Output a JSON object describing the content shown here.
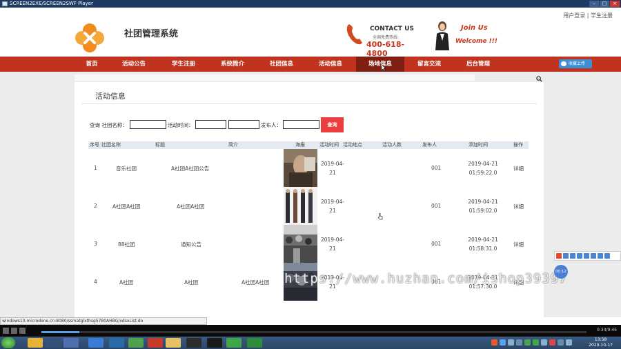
{
  "window": {
    "title": "SCREEN2EXE/SCREEN2SWF Player"
  },
  "header": {
    "top_links": "用户登录 | 学生注册",
    "site_name": "社团管理系统",
    "contact_title": "CONTACT US",
    "contact_sub": "全国免费热线:",
    "contact_phone": "400-618-4800",
    "join_line1": "Join Us",
    "join_line2": "Welcome !!!"
  },
  "nav": {
    "items": [
      {
        "label": "首页"
      },
      {
        "label": "活动公告"
      },
      {
        "label": "学生注册"
      },
      {
        "label": "系统简介"
      },
      {
        "label": "社团信息"
      },
      {
        "label": "活动信息"
      },
      {
        "label": "场地信息"
      },
      {
        "label": "留言交流"
      },
      {
        "label": "后台管理"
      }
    ],
    "active_index": 6,
    "share_label": "收藏上传"
  },
  "page": {
    "title": "活动信息"
  },
  "filter": {
    "prefix_label": "查询 社团名称：",
    "time_label": "活动时间：",
    "publisher_label": "发布人：",
    "club_value": "",
    "time_from": "",
    "time_to": "",
    "publisher_value": "",
    "query_button": "查询"
  },
  "table": {
    "headers": [
      "序号",
      "社团名称",
      "标题",
      "简介",
      "海报",
      "活动时间",
      "活动地点",
      "活动人数",
      "发布人",
      "添加时间",
      "操作"
    ],
    "rows": [
      {
        "no": "1",
        "club": "音乐社团",
        "title": "A社团A社团公告",
        "intro": "",
        "date_y": "2019-04-",
        "date_d": "21",
        "place": "",
        "people": "",
        "publisher": "001",
        "add_date": "2019-04-21",
        "add_time": "01:59:22.0",
        "action": "详细"
      },
      {
        "no": "2",
        "club": "A社团A社团",
        "title": "A社团A社团",
        "intro": "",
        "date_y": "2019-04-",
        "date_d": "21",
        "place": "",
        "people": "",
        "publisher": "001",
        "add_date": "2019-04-21",
        "add_time": "01:59:02.0",
        "action": "详细"
      },
      {
        "no": "3",
        "club": "88社团",
        "title": "通知公告",
        "intro": "",
        "date_y": "2019-04-",
        "date_d": "21",
        "place": "",
        "people": "",
        "publisher": "001",
        "add_date": "2019-04-21",
        "add_time": "01:58:31.0",
        "action": "详细"
      },
      {
        "no": "4",
        "club": "A社团",
        "title": "A社团",
        "intro": "A社团A社团",
        "date_y": "2019-04-",
        "date_d": "21",
        "place": "",
        "people": "",
        "publisher": "001",
        "add_date": "2019-04-21",
        "add_time": "01:57:30.0",
        "action": "详细"
      }
    ]
  },
  "watermark": "https://www.huzhan.com/ishop39397",
  "status_url": "windows10.microdone.cn:8080/ssmatglxthsg5780AHBG/xdsxList.do",
  "player": {
    "time": "0:34/9:45",
    "progress": 0.07
  },
  "taskbar": {
    "clock_time": "13:58",
    "clock_date": "2020-10-17"
  },
  "float_badge": "00:12",
  "colors": {
    "nav_bg": "#c0331f",
    "nav_active": "#7e1f12",
    "query_button": "#ea3f3f",
    "accent_red": "#c8361f"
  }
}
